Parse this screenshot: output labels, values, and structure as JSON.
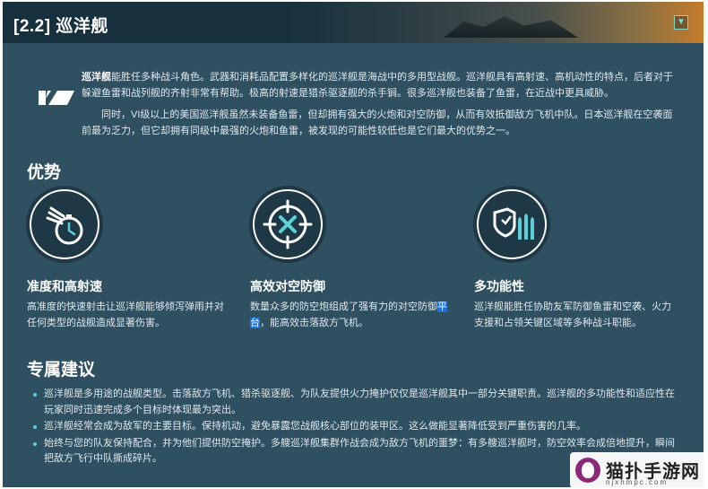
{
  "header": {
    "title": "[2.2] 巡洋舰",
    "collapse_icon": "chevron-down-icon"
  },
  "intro": {
    "bold": "巡洋舰",
    "p1": "能胜任多种战斗角色。武器和消耗品配置多样化的巡洋舰是海战中的多用型战舰。巡洋舰具有高射速、高机动性的特点，后者对于躲避鱼雷和战列舰的齐射非常有帮助。极高的射速是猎杀驱逐舰的杀手锏。很多巡洋舰也装备了鱼雷，在近战中更具威胁。",
    "p2": "同时，VI级以上的美国巡洋舰虽然未装备鱼雷，但却拥有强大的火炮和对空防御，从而有效抵御敌方飞机中队。日本巡洋舰在空袭面前最为乏力，但它却拥有同级中最强的火炮和鱼雷，被发现的可能性较低也是它们最大的优势之一。"
  },
  "advantages": {
    "title": "优势",
    "items": [
      {
        "icon": "stopwatch-icon",
        "title": "准度和高射速",
        "desc": "高准度的快速射击让巡洋舰能够倾泻弹雨并对任何类型的战舰造成显著伤害。"
      },
      {
        "icon": "crosshair-icon",
        "title": "高效对空防御",
        "desc_a": "数量众多的防空炮组成了强有力的对空防御",
        "desc_hl1": "平",
        "desc_hl2": "台",
        "desc_b": "，能高效击落敌方飞机。"
      },
      {
        "icon": "shield-shells-icon",
        "title": "多功能性",
        "desc": "巡洋舰能胜任协助友军防御鱼雷和空袭、火力支援和占领关键区域等多种战斗职能。"
      }
    ]
  },
  "advice": {
    "title": "专属建议",
    "items": [
      "巡洋舰是多用途的战舰类型。击落敌方飞机、猎杀驱逐舰、为队友提供火力掩护仅仅是巡洋舰其中一部分关键职责。巡洋舰的多功能性和适应性在玩家同时迅速完成多个目标时体现最为突出。",
      "巡洋舰经常会成为敌军的主要目标。保持机动，避免暴露您战舰核心部位的装甲区。这么做能显著降低受到严重伤害的几率。",
      "始终与您的队友保持配合，并为他们提供防空掩护。多艘巡洋舰集群作战会成为敌方飞机的噩梦：有多艘巡洋舰时，防空效率会成倍地提升，瞬间把敌方飞行中队撕成碎片。"
    ]
  },
  "watermark": {
    "text": "猫扑手游网",
    "url": "njxhmpc.com"
  },
  "colors": {
    "panel": "#2f5060",
    "accent": "#5ecfd6",
    "icon_bg": "#1f3846",
    "highlight": "#1f6fd9"
  }
}
